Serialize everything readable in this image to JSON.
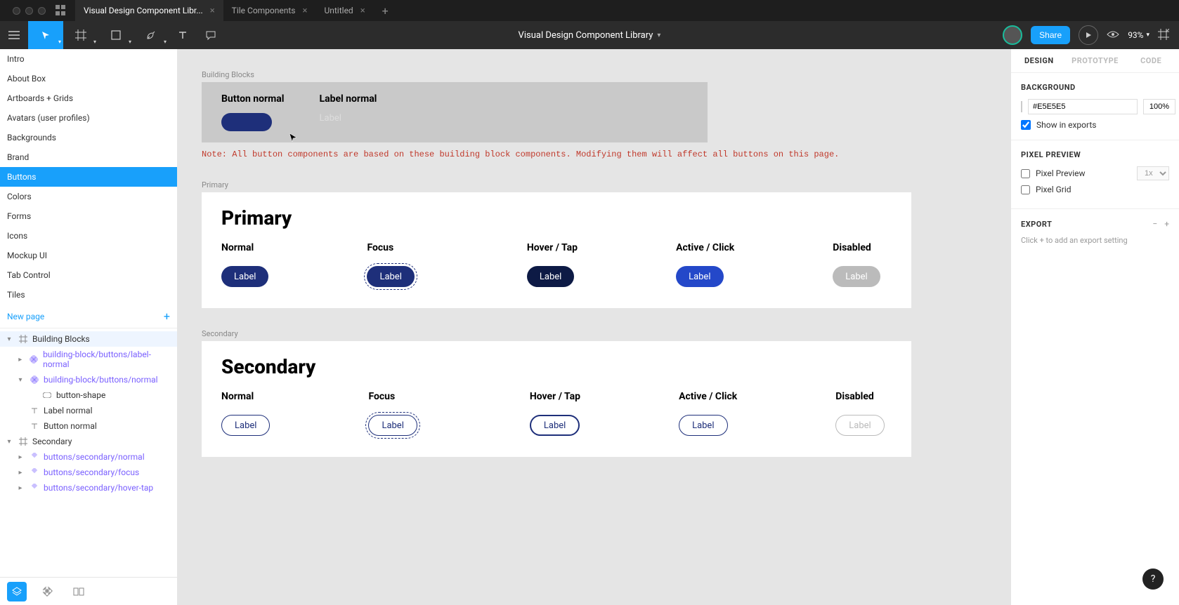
{
  "tabs": {
    "t0": "Visual Design Component Libr...",
    "t1": "Tile Components",
    "t2": "Untitled"
  },
  "doc_title": "Visual Design Component Library",
  "share_label": "Share",
  "zoom": "93%",
  "pages": [
    "Intro",
    "About Box",
    "Artboards + Grids",
    "Avatars (user profiles)",
    "Backgrounds",
    "Brand",
    "Buttons",
    "Colors",
    "Forms",
    "Icons",
    "Mockup UI",
    "Tab Control",
    "Tiles"
  ],
  "new_page": "New page",
  "layers": {
    "bb_frame": "Building Blocks",
    "comp_label_normal": "building-block/buttons/label-normal",
    "comp_normal": "building-block/buttons/normal",
    "shape": "button-shape",
    "text_label_normal": "Label normal",
    "text_button_normal": "Button normal",
    "secondary_frame": "Secondary",
    "comp_sec_normal": "buttons/secondary/normal",
    "comp_sec_focus": "buttons/secondary/focus",
    "comp_sec_hover": "buttons/secondary/hover-tap"
  },
  "canvas": {
    "frame_bb": "Building Blocks",
    "bb_btn_title": "Button normal",
    "bb_lbl_title": "Label normal",
    "bb_lbl_text": "Label",
    "note": "Note: All button components are based on these building block components. Modifying them will affect all buttons on this page.",
    "frame_primary": "Primary",
    "section_primary": "Primary",
    "frame_secondary": "Secondary",
    "section_secondary": "Secondary",
    "states": [
      "Normal",
      "Focus",
      "Hover / Tap",
      "Active / Click",
      "Disabled"
    ],
    "btn_label": "Label"
  },
  "right": {
    "tabs": [
      "DESIGN",
      "PROTOTYPE",
      "CODE"
    ],
    "background": "BACKGROUND",
    "bg_hex": "#E5E5E5",
    "bg_opacity": "100%",
    "show_exports": "Show in exports",
    "pixel_preview_sec": "PIXEL PREVIEW",
    "pixel_preview": "Pixel Preview",
    "pp_scale": "1x",
    "pixel_grid": "Pixel Grid",
    "export": "EXPORT",
    "export_hint": "Click + to add an export setting"
  }
}
